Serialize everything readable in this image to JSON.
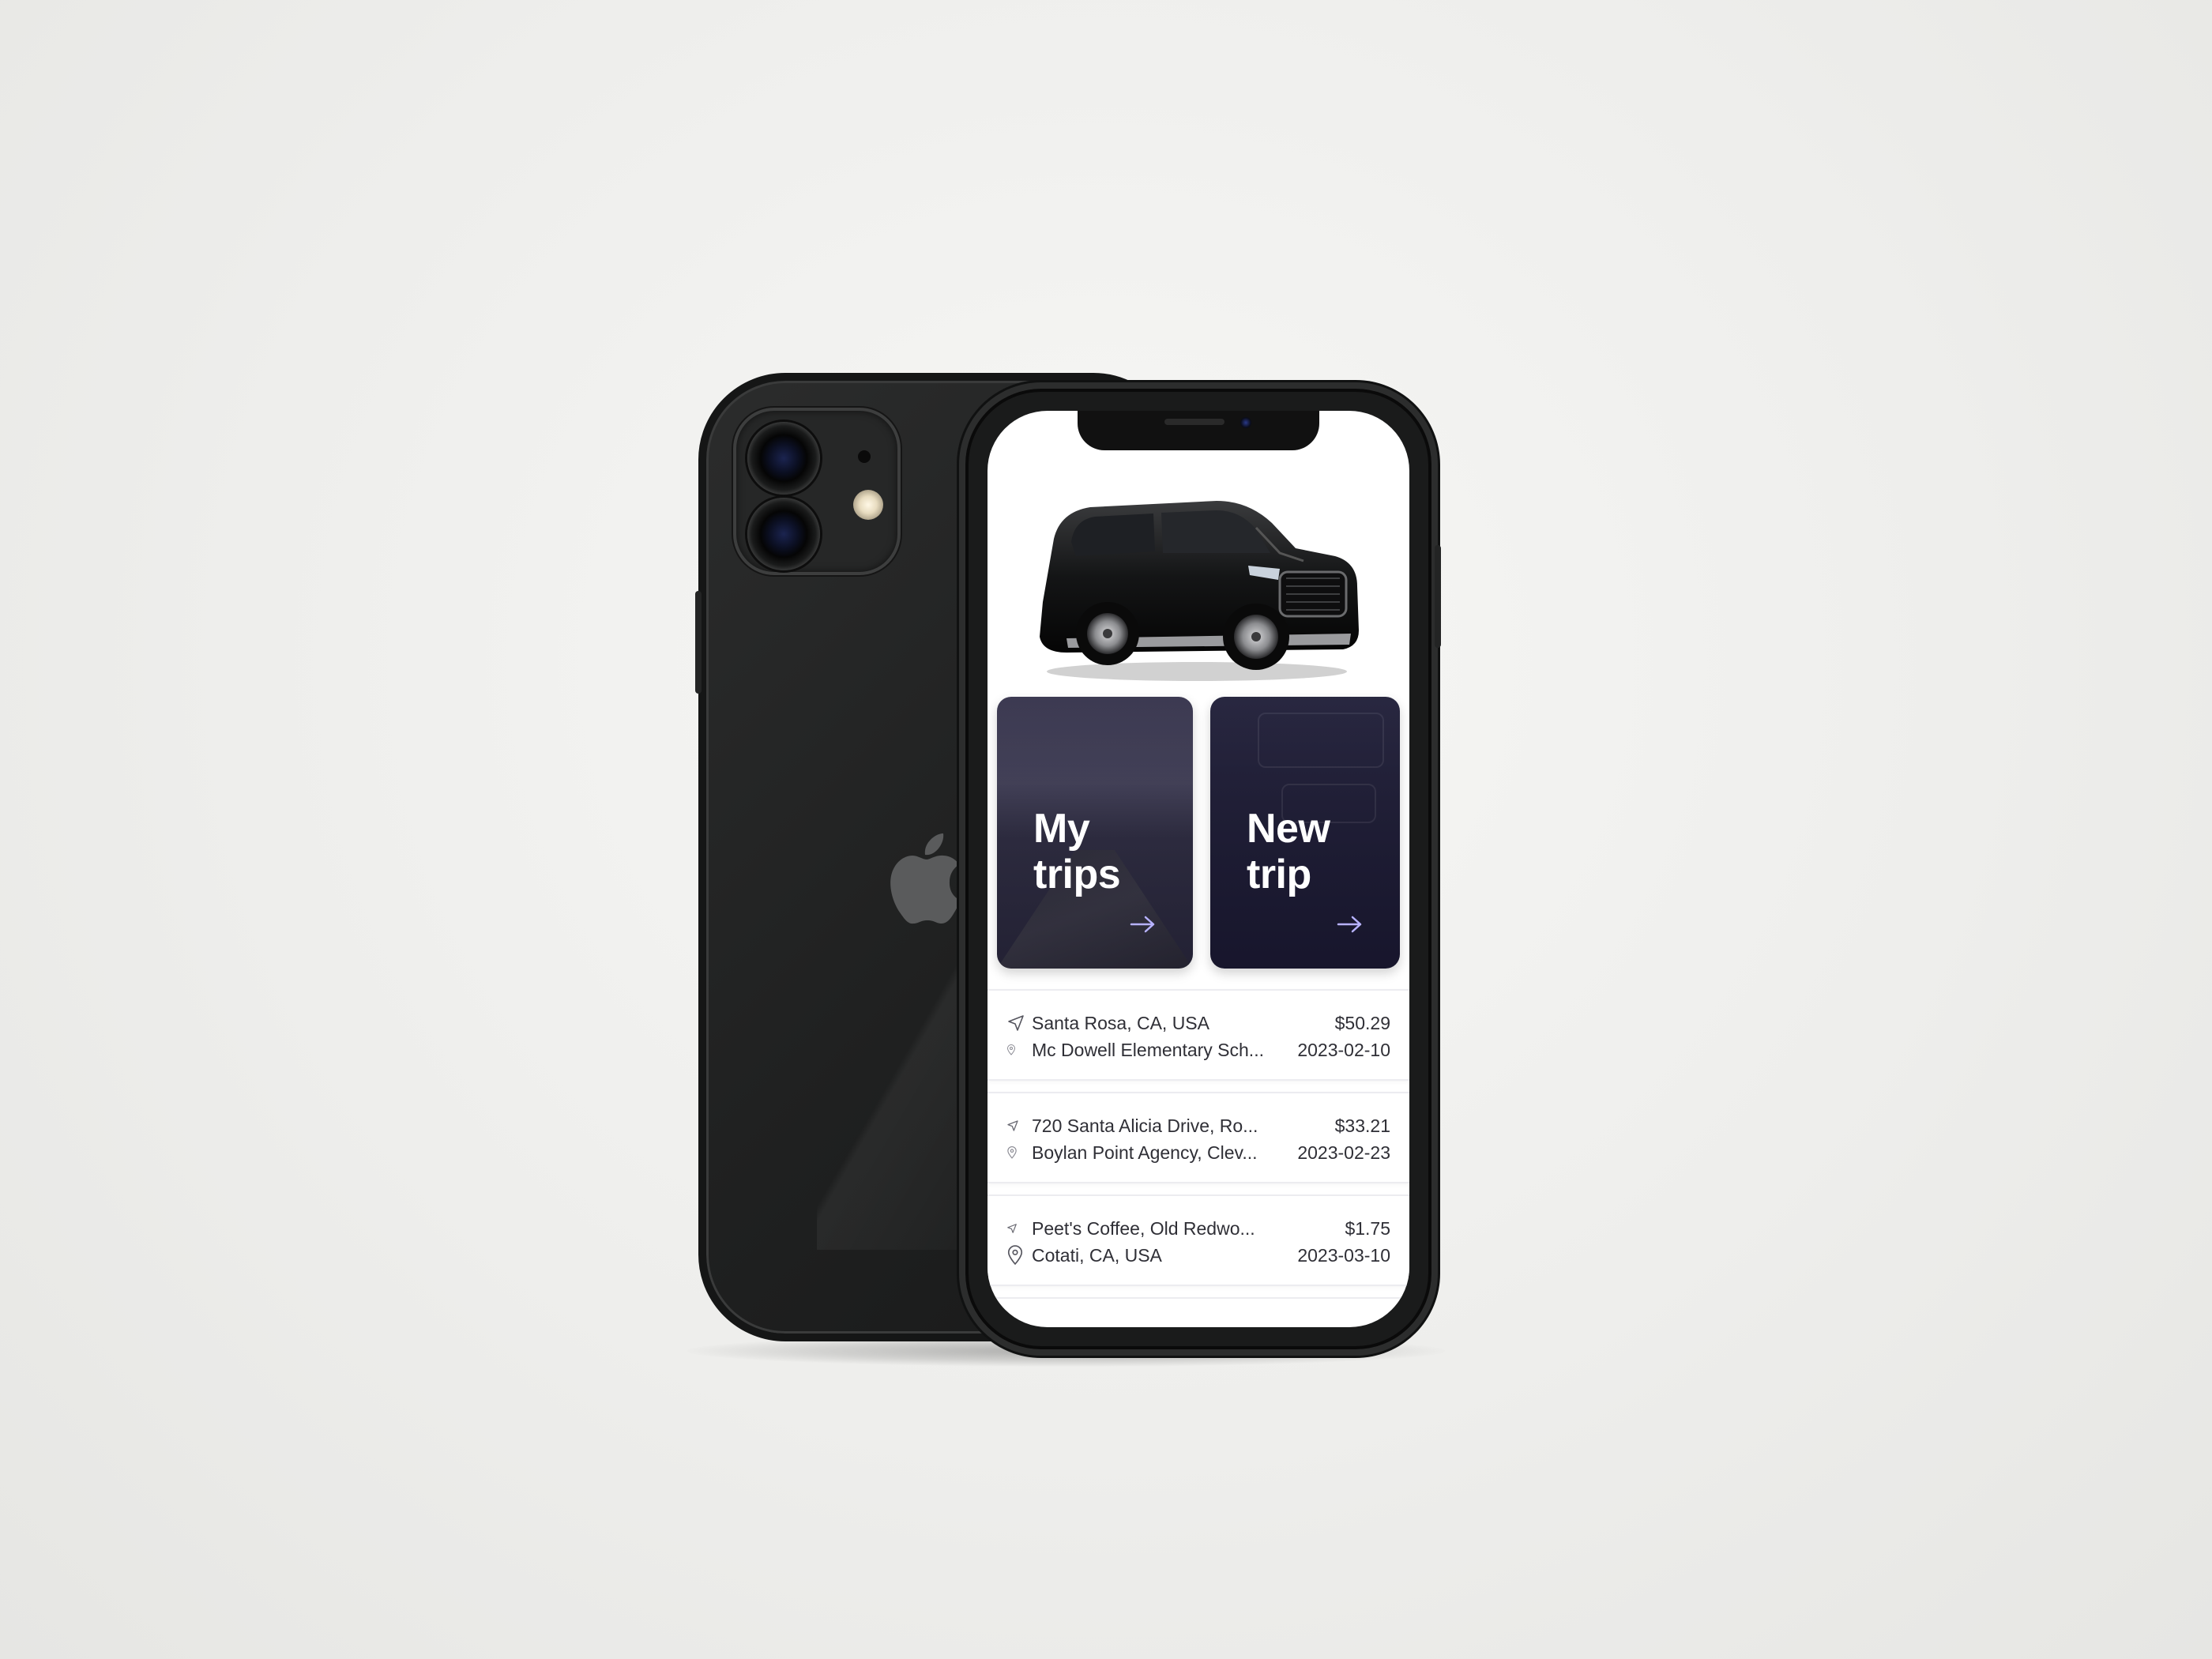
{
  "app": {
    "cards": {
      "my_trips": "My trips",
      "new_trip": "New trip"
    },
    "trips": [
      {
        "from": "Santa Rosa, CA, USA",
        "to": "Mc Dowell Elementary Sch...",
        "price": "$50.29",
        "date": "2023-02-10"
      },
      {
        "from": "720 Santa Alicia Drive, Ro...",
        "to": "Boylan Point Agency, Clev...",
        "price": "$33.21",
        "date": "2023-02-23"
      },
      {
        "from": "Peet's Coffee, Old Redwo...",
        "to": "Cotati, CA, USA",
        "price": "$1.75",
        "date": "2023-03-10"
      }
    ]
  },
  "icons": {
    "origin": "navigation-arrow-icon",
    "destination": "map-pin-icon",
    "card_arrow": "arrow-right-icon"
  },
  "colors": {
    "accent_arrow": "#b7b2ff",
    "card_bg": "#2c2a44",
    "text": "#2f2f36",
    "phone_body": "#1f2020"
  }
}
